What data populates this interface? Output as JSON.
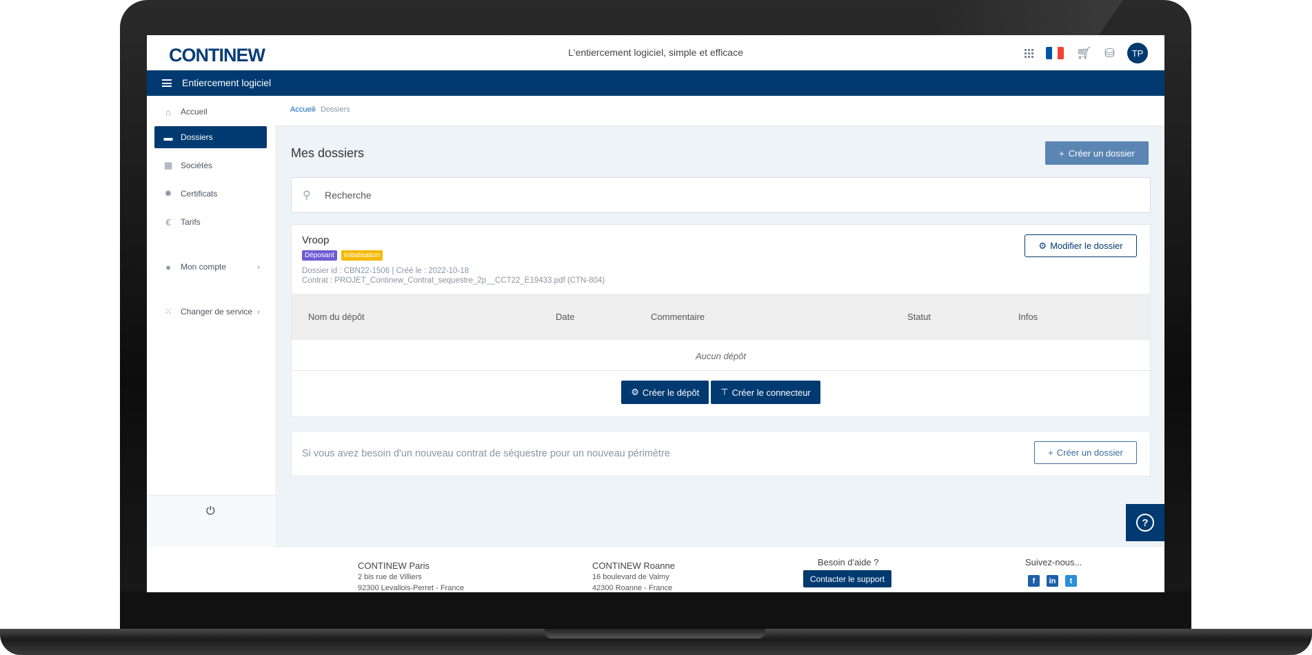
{
  "header": {
    "logo_text": "CONTINEW",
    "tagline": "L'entiercement logiciel, simple et efficace",
    "avatar_initials": "TP",
    "flag_colors": [
      "#0055a4",
      "#ffffff",
      "#ef4135"
    ]
  },
  "navbar": {
    "title": "Entiercement logiciel"
  },
  "sidebar": {
    "items": [
      {
        "label": "Accueil",
        "icon": "home-icon"
      },
      {
        "label": "Dossiers",
        "icon": "folder-icon",
        "active": true
      },
      {
        "label": "Sociétés",
        "icon": "building-icon"
      },
      {
        "label": "Certificats",
        "icon": "certificate-icon"
      },
      {
        "label": "Tarifs",
        "icon": "euro-icon"
      },
      {
        "label": "Mon compte",
        "icon": "user-icon"
      },
      {
        "label": "Changer de service",
        "icon": "grid-icon"
      }
    ]
  },
  "breadcrumb": {
    "home": "Accueil",
    "current": "Dossiers"
  },
  "main": {
    "title": "Mes dossiers",
    "create_button": "Créer un dossier",
    "search_placeholder": "Recherche"
  },
  "dossier": {
    "name": "Vroop",
    "badges": [
      {
        "label": "Déposant",
        "color": "#6f5bd3"
      },
      {
        "label": "Initialisation",
        "color": "#f5b800"
      }
    ],
    "meta_line1": "Dossier id : CBN22-1506 | Créé le : 2022-10-18",
    "meta_line2": "Contrat : PROJET_Continew_Contrat_sequestre_2p__CCT22_E19433.pdf (CTN-804)",
    "modify_button": "Modifier le dossier",
    "table_headers": [
      "Nom du dépôt",
      "Date",
      "Commentaire",
      "Statut",
      "Infos"
    ],
    "empty_text": "Aucun dépôt",
    "create_deposit_button": "Créer le dépôt",
    "create_connector_button": "Créer le connecteur"
  },
  "new_contract": {
    "text": "Si vous avez besoin d'un nouveau contrat de séquestre pour un nouveau périmètre",
    "button": "Créer un dossier"
  },
  "footer": {
    "paris_title": "CONTINEW Paris",
    "paris_addr1": "2 bis rue de Villiers",
    "paris_addr2": "92300 Levallois-Perret - France",
    "roanne_title": "CONTINEW Roanne",
    "roanne_addr1": "16 boulevard de Valmy",
    "roanne_addr2": "42300 Roanne - France",
    "help_title": "Besoin d'aide ?",
    "support_button": "Contacter le support",
    "follow_title": "Suivez-nous..."
  }
}
